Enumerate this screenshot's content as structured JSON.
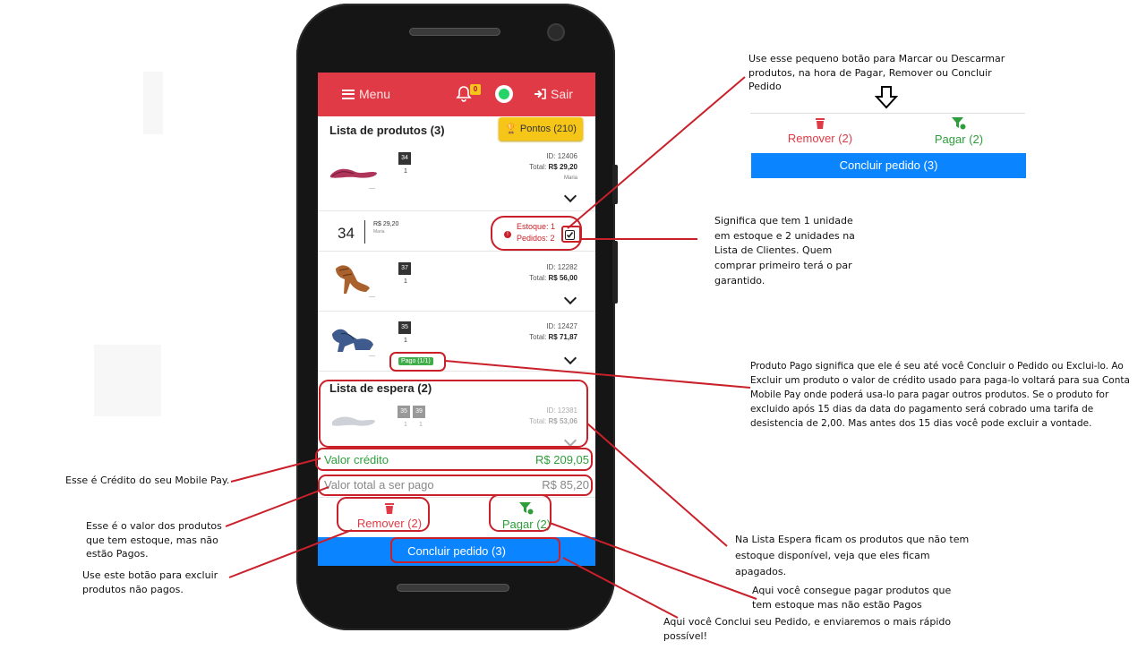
{
  "app": {
    "menu_label": "Menu",
    "notif_count": "0",
    "exit_label": "Sair",
    "colors": {
      "topbar": "#e03a46",
      "primary": "#0a84ff",
      "gold": "#f5c518",
      "green": "#3fae4a",
      "annotation": "#c9202a"
    }
  },
  "produtos": {
    "title": "Lista de produtos (3)",
    "pontos_label": "Pontos (210)",
    "items": [
      {
        "size": "34",
        "qty": "1",
        "id": "ID: 12406",
        "total_label": "Total:",
        "total": "R$ 29,20",
        "extra": "Maria"
      },
      {
        "size": "37",
        "qty": "1",
        "id": "ID: 12282",
        "total_label": "Total:",
        "total": "R$ 56,00"
      },
      {
        "size": "35",
        "qty": "1",
        "id": "ID: 12427",
        "total_label": "Total:",
        "total": "R$ 71,87",
        "pago": "Pago (1/1)"
      }
    ],
    "expanded": {
      "size": "34",
      "price": "R$ 29,20",
      "name": "Maria",
      "estoque": "Estoque: 1",
      "pedidos": "Pedidos: 2"
    }
  },
  "espera": {
    "title": "Lista de espera (2)",
    "item": {
      "sizes": [
        "35",
        "39"
      ],
      "qtys": [
        "1",
        "1"
      ],
      "id": "ID: 12381",
      "total_label": "Total:",
      "total": "R$ 53,06"
    }
  },
  "totals": {
    "credito_label": "Valor crédito",
    "credito_value": "R$ 209,05",
    "total_label": "Valor total a ser pago",
    "total_value": "R$ 85,20"
  },
  "actions": {
    "remover": "Remover (2)",
    "pagar": "Pagar (2)",
    "concluir": "Concluir pedido (3)"
  },
  "annotations": {
    "top_note": "Use esse pequeno botão para Marcar ou Descarmar produtos, na hora de Pagar, Remover ou Concluir Pedido",
    "estoque_note": "Significa que tem 1 unidade em estoque e 2 unidades na Lista de Clientes. Quem comprar primeiro terá o par garantido.",
    "pago_note": "Produto Pago significa que ele é seu até você Concluir o Pedido ou Exclui-lo. Ao Excluir um produto o valor de crédito usado para paga-lo voltará para sua Conta Mobile Pay onde poderá usa-lo para pagar outros produtos. Se o produto for excluido após 15 dias da data do pagamento será cobrado uma tarifa de desistencia de 2,00. Mas antes dos 15 dias você pode excluir a vontade.",
    "espera_note": "Na Lista Espera ficam os produtos que não tem estoque disponível, veja que eles ficam apagados.",
    "pagar_note": "Aqui você consegue pagar produtos que tem estoque mas não estão Pagos",
    "concluir_note": "Aqui você Conclui seu Pedido, e enviaremos o mais rápido possível!",
    "credito_note": "Esse é Crédito do seu Mobile Pay.",
    "total_note": "Esse é o valor dos produtos que tem estoque, mas não estão Pagos.",
    "remover_note": "Use este botão para excluir produtos não pagos."
  },
  "preview": {
    "remover": "Remover (2)",
    "pagar": "Pagar (2)",
    "concluir": "Concluir pedido (3)"
  }
}
